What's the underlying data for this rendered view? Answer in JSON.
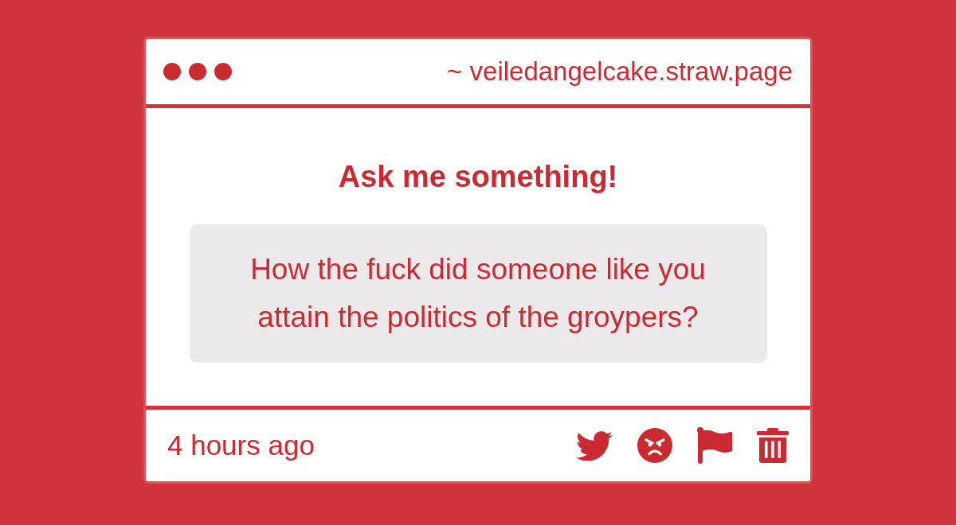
{
  "window": {
    "address": "~ veiledangelcake.straw.page"
  },
  "heading": "Ask me something!",
  "question": "How the fuck did someone like you attain the politics of the groypers?",
  "footer": {
    "time": "4 hours ago",
    "actions": [
      {
        "kind": "bird"
      },
      {
        "kind": "angry"
      },
      {
        "kind": "flag"
      },
      {
        "kind": "trash"
      }
    ]
  }
}
